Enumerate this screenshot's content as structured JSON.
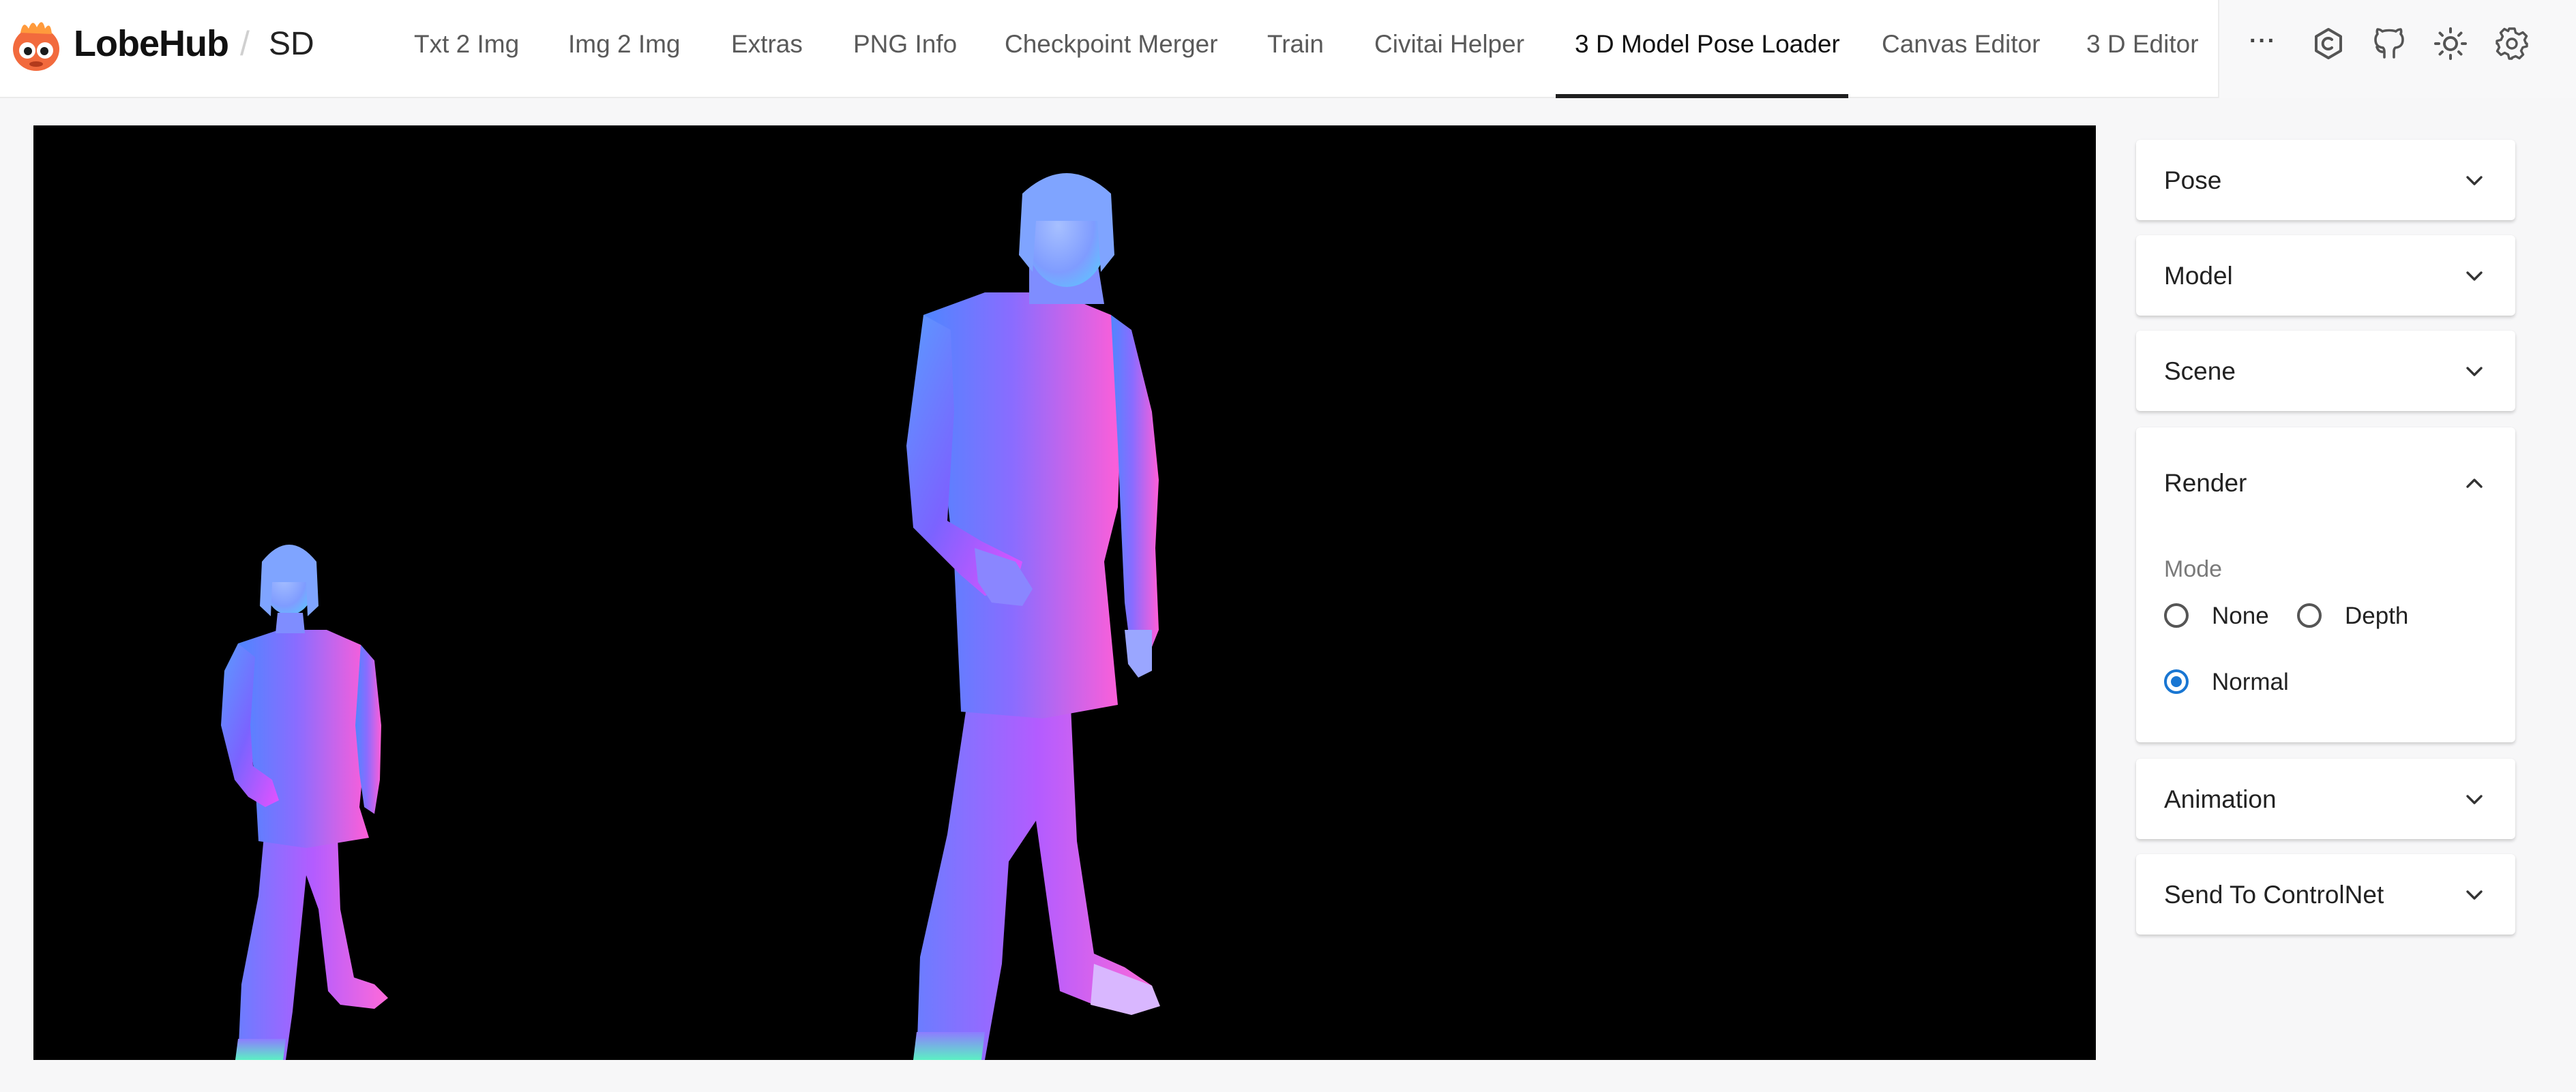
{
  "header": {
    "brand": "LobeHub",
    "separator": "/",
    "sub": "SD",
    "tabs": [
      {
        "label": "Txt 2 Img",
        "active": false
      },
      {
        "label": "Img 2 Img",
        "active": false
      },
      {
        "label": "Extras",
        "active": false
      },
      {
        "label": "PNG Info",
        "active": false
      },
      {
        "label": "Checkpoint Merger",
        "active": false
      },
      {
        "label": "Train",
        "active": false
      },
      {
        "label": "Civitai Helper",
        "active": false
      },
      {
        "label": "3 D Model Pose Loader",
        "active": true
      },
      {
        "label": "Canvas Editor",
        "active": false
      },
      {
        "label": "3 D Editor",
        "active": false
      }
    ],
    "more_label": "···",
    "icons": [
      "openai-hexagon-icon",
      "github-icon",
      "theme-sun-icon",
      "settings-gear-icon"
    ]
  },
  "sidebar": {
    "sections": [
      {
        "title": "Pose",
        "expanded": false
      },
      {
        "title": "Model",
        "expanded": false
      },
      {
        "title": "Scene",
        "expanded": false
      },
      {
        "title": "Render",
        "expanded": true
      },
      {
        "title": "Animation",
        "expanded": false
      },
      {
        "title": "Send To ControlNet",
        "expanded": false
      }
    ],
    "render": {
      "mode_label": "Mode",
      "options": [
        {
          "label": "None",
          "checked": false
        },
        {
          "label": "Depth",
          "checked": false
        },
        {
          "label": "Normal",
          "checked": true
        }
      ]
    }
  },
  "colors": {
    "accent": "#1976d2",
    "viewport_bg": "#000000",
    "normal_map_blue": "#5a6cff",
    "normal_map_magenta": "#e05cf0",
    "normal_map_cyan": "#48d7ff"
  }
}
